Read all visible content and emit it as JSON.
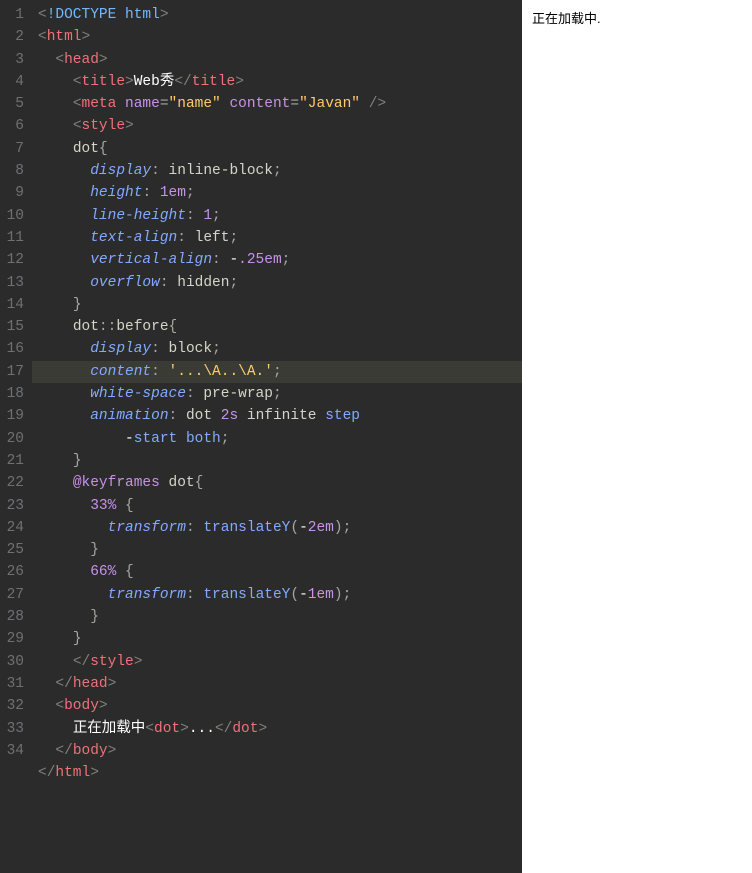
{
  "editor": {
    "highlight_line": 17,
    "lines": [
      {
        "n": 1,
        "tokens": [
          [
            "c-angle",
            "<"
          ],
          [
            "c-doctype",
            "!DOCTYPE html"
          ],
          [
            "c-angle",
            ">"
          ]
        ]
      },
      {
        "n": 2,
        "indent": 0,
        "tokens": [
          [
            "c-angle",
            "<"
          ],
          [
            "c-tag",
            "html"
          ],
          [
            "c-angle",
            ">"
          ]
        ]
      },
      {
        "n": 3,
        "indent": 1,
        "tokens": [
          [
            "c-angle",
            "<"
          ],
          [
            "c-tag",
            "head"
          ],
          [
            "c-angle",
            ">"
          ]
        ]
      },
      {
        "n": 4,
        "indent": 2,
        "tokens": [
          [
            "c-angle",
            "<"
          ],
          [
            "c-tag",
            "title"
          ],
          [
            "c-angle",
            ">"
          ],
          [
            "c-white",
            "Web秀"
          ],
          [
            "c-angle",
            "</"
          ],
          [
            "c-tag",
            "title"
          ],
          [
            "c-angle",
            ">"
          ]
        ]
      },
      {
        "n": 5,
        "indent": 2,
        "tokens": [
          [
            "c-angle",
            "<"
          ],
          [
            "c-tag",
            "meta "
          ],
          [
            "c-kw",
            "name"
          ],
          [
            "c-punct",
            "="
          ],
          [
            "c-str",
            "\"name\""
          ],
          [
            "c-punct",
            " "
          ],
          [
            "c-kw",
            "content"
          ],
          [
            "c-punct",
            "="
          ],
          [
            "c-str",
            "\"Javan\""
          ],
          [
            "c-angle",
            " />"
          ]
        ]
      },
      {
        "n": 6,
        "indent": 2,
        "tokens": [
          [
            "c-angle",
            "<"
          ],
          [
            "c-tag",
            "style"
          ],
          [
            "c-angle",
            ">"
          ]
        ]
      },
      {
        "n": 7,
        "indent": 2,
        "tokens": [
          [
            "c-val",
            "dot"
          ],
          [
            "c-punct",
            "{"
          ]
        ]
      },
      {
        "n": 8,
        "indent": 3,
        "tokens": [
          [
            "c-prop",
            "display"
          ],
          [
            "c-punct",
            ": "
          ],
          [
            "c-val",
            "inline-block"
          ],
          [
            "c-punct",
            ";"
          ]
        ]
      },
      {
        "n": 9,
        "indent": 3,
        "tokens": [
          [
            "c-prop",
            "height"
          ],
          [
            "c-punct",
            ": "
          ],
          [
            "c-num",
            "1"
          ],
          [
            "c-kw",
            "em"
          ],
          [
            "c-punct",
            ";"
          ]
        ]
      },
      {
        "n": 10,
        "indent": 3,
        "tokens": [
          [
            "c-prop",
            "line-height"
          ],
          [
            "c-punct",
            ": "
          ],
          [
            "c-num",
            "1"
          ],
          [
            "c-punct",
            ";"
          ]
        ]
      },
      {
        "n": 11,
        "indent": 3,
        "tokens": [
          [
            "c-prop",
            "text-align"
          ],
          [
            "c-punct",
            ": "
          ],
          [
            "c-val",
            "left"
          ],
          [
            "c-punct",
            ";"
          ]
        ]
      },
      {
        "n": 12,
        "indent": 3,
        "tokens": [
          [
            "c-prop",
            "vertical-align"
          ],
          [
            "c-punct",
            ": "
          ],
          [
            "c-dash",
            "-"
          ],
          [
            "c-num",
            ".25"
          ],
          [
            "c-kw",
            "em"
          ],
          [
            "c-punct",
            ";"
          ]
        ]
      },
      {
        "n": 13,
        "indent": 3,
        "tokens": [
          [
            "c-prop",
            "overflow"
          ],
          [
            "c-punct",
            ": "
          ],
          [
            "c-val",
            "hidden"
          ],
          [
            "c-punct",
            ";"
          ]
        ]
      },
      {
        "n": 14,
        "indent": 2,
        "tokens": [
          [
            "c-punct",
            "}"
          ]
        ]
      },
      {
        "n": 15,
        "indent": 2,
        "tokens": [
          [
            "c-val",
            "dot"
          ],
          [
            "c-punct",
            "::"
          ],
          [
            "c-val",
            "before"
          ],
          [
            "c-punct",
            "{"
          ]
        ]
      },
      {
        "n": 16,
        "indent": 3,
        "tokens": [
          [
            "c-prop",
            "display"
          ],
          [
            "c-punct",
            ": "
          ],
          [
            "c-val",
            "block"
          ],
          [
            "c-punct",
            ";"
          ]
        ]
      },
      {
        "n": 17,
        "indent": 3,
        "tokens": [
          [
            "c-prop",
            "content"
          ],
          [
            "c-punct",
            ": "
          ],
          [
            "c-str",
            "'...\\A..\\A.'"
          ],
          [
            "c-punct",
            ";"
          ]
        ]
      },
      {
        "n": 18,
        "indent": 3,
        "tokens": [
          [
            "c-prop",
            "white-space"
          ],
          [
            "c-punct",
            ": "
          ],
          [
            "c-val",
            "pre-wrap"
          ],
          [
            "c-punct",
            ";"
          ]
        ]
      },
      {
        "n": 19,
        "indent": 3,
        "tokens": [
          [
            "c-prop",
            "animation"
          ],
          [
            "c-punct",
            ": "
          ],
          [
            "c-val",
            "dot "
          ],
          [
            "c-dur",
            "2"
          ],
          [
            "c-kw",
            "s"
          ],
          [
            "c-val",
            " infinite "
          ],
          [
            "c-inf",
            "step"
          ]
        ]
      },
      {
        "n": "",
        "indent": 5,
        "tokens": [
          [
            "c-dash",
            "-"
          ],
          [
            "c-inf",
            "start "
          ],
          [
            "c-both",
            "both"
          ],
          [
            "c-punct",
            ";"
          ]
        ]
      },
      {
        "n": 20,
        "indent": 2,
        "tokens": [
          [
            "c-punct",
            "}"
          ]
        ]
      },
      {
        "n": 21,
        "cdot": true,
        "indent": 2,
        "tokens": [
          [
            "c-kw",
            "@keyframes"
          ],
          [
            "c-val",
            " dot"
          ],
          [
            "c-punct",
            "{"
          ]
        ]
      },
      {
        "n": 22,
        "indent": 3,
        "tokens": [
          [
            "c-num",
            "33"
          ],
          [
            "c-kw",
            "%"
          ],
          [
            "c-punct",
            " {"
          ]
        ]
      },
      {
        "n": 23,
        "indent": 4,
        "tokens": [
          [
            "c-prop",
            "transform"
          ],
          [
            "c-punct",
            ": "
          ],
          [
            "c-func",
            "translateY"
          ],
          [
            "c-punct",
            "("
          ],
          [
            "c-dash",
            "-"
          ],
          [
            "c-num",
            "2"
          ],
          [
            "c-kw",
            "em"
          ],
          [
            "c-punct",
            ");"
          ]
        ]
      },
      {
        "n": 24,
        "indent": 3,
        "tokens": [
          [
            "c-punct",
            "}"
          ]
        ]
      },
      {
        "n": 25,
        "indent": 3,
        "tokens": [
          [
            "c-num",
            "66"
          ],
          [
            "c-kw",
            "%"
          ],
          [
            "c-punct",
            " {"
          ]
        ]
      },
      {
        "n": 26,
        "indent": 4,
        "tokens": [
          [
            "c-prop",
            "transform"
          ],
          [
            "c-punct",
            ": "
          ],
          [
            "c-func",
            "translateY"
          ],
          [
            "c-punct",
            "("
          ],
          [
            "c-dash",
            "-"
          ],
          [
            "c-num",
            "1"
          ],
          [
            "c-kw",
            "em"
          ],
          [
            "c-punct",
            ");"
          ]
        ]
      },
      {
        "n": 27,
        "indent": 3,
        "tokens": [
          [
            "c-punct",
            "}"
          ]
        ]
      },
      {
        "n": 28,
        "indent": 2,
        "tokens": [
          [
            "c-punct",
            "}"
          ]
        ]
      },
      {
        "n": 29,
        "indent": 2,
        "tokens": [
          [
            "c-angle",
            "</"
          ],
          [
            "c-tag",
            "style"
          ],
          [
            "c-angle",
            ">"
          ]
        ]
      },
      {
        "n": 30,
        "indent": 1,
        "tokens": [
          [
            "c-angle",
            "</"
          ],
          [
            "c-tag",
            "head"
          ],
          [
            "c-angle",
            ">"
          ]
        ]
      },
      {
        "n": 31,
        "indent": 1,
        "tokens": [
          [
            "c-angle",
            "<"
          ],
          [
            "c-tag",
            "body"
          ],
          [
            "c-angle",
            ">"
          ]
        ]
      },
      {
        "n": 32,
        "indent": 2,
        "tokens": [
          [
            "c-white",
            "正在加载中"
          ],
          [
            "c-angle",
            "<"
          ],
          [
            "c-tag",
            "dot"
          ],
          [
            "c-angle",
            ">"
          ],
          [
            "c-white",
            "..."
          ],
          [
            "c-angle",
            "</"
          ],
          [
            "c-tag",
            "dot"
          ],
          [
            "c-angle",
            ">"
          ]
        ]
      },
      {
        "n": 33,
        "indent": 1,
        "tokens": [
          [
            "c-angle",
            "</"
          ],
          [
            "c-tag",
            "body"
          ],
          [
            "c-angle",
            ">"
          ]
        ]
      },
      {
        "n": 34,
        "indent": 0,
        "tokens": [
          [
            "c-angle",
            "</"
          ],
          [
            "c-tag",
            "html"
          ],
          [
            "c-angle",
            ">"
          ]
        ]
      }
    ]
  },
  "preview": {
    "text": "正在加载中.",
    "title": "Web秀"
  }
}
